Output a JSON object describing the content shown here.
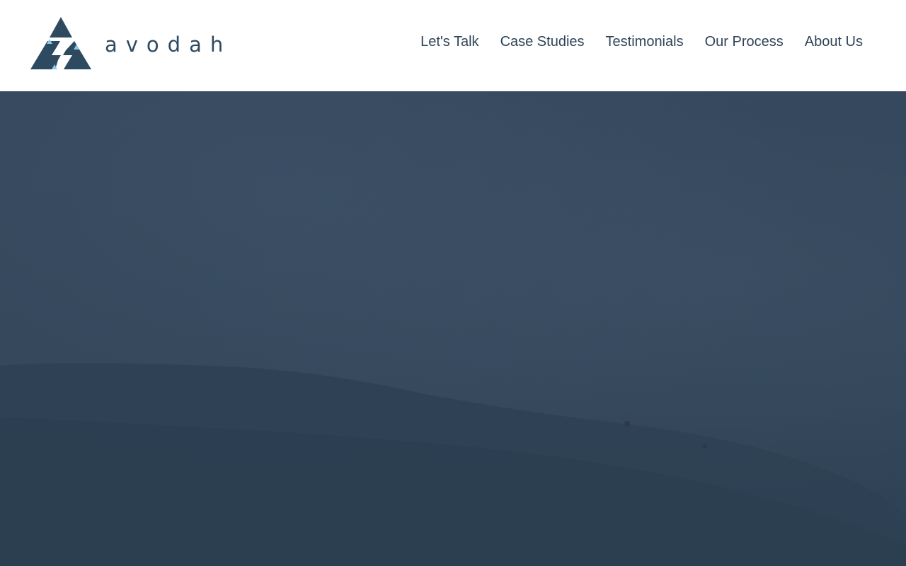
{
  "brand": {
    "name": "avodah",
    "logo_icon": "triangle-mountain-logo-icon",
    "primary_color": "#2e4a61",
    "accent_color": "#8ec7e8"
  },
  "nav": {
    "items": [
      {
        "label": "Let's Talk"
      },
      {
        "label": "Case Studies"
      },
      {
        "label": "Testimonials"
      },
      {
        "label": "Our Process"
      },
      {
        "label": "About Us"
      }
    ]
  },
  "hero": {
    "overlay_color": "#34475b"
  }
}
